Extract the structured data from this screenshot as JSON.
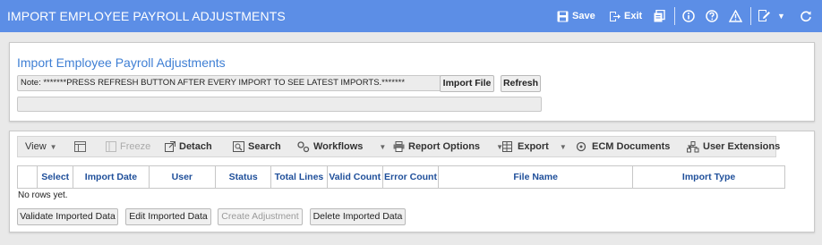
{
  "header": {
    "title": "IMPORT EMPLOYEE PAYROLL ADJUSTMENTS",
    "save_label": "Save",
    "exit_label": "Exit"
  },
  "import_section": {
    "title": "Import Employee Payroll Adjustments",
    "note": "Note: *******PRESS REFRESH BUTTON AFTER EVERY IMPORT TO SEE LATEST IMPORTS.*******",
    "import_file_label": "Import File",
    "refresh_label": "Refresh"
  },
  "toolbar": {
    "view": "View",
    "freeze": "Freeze",
    "detach": "Detach",
    "search": "Search",
    "workflows": "Workflows",
    "report_options": "Report Options",
    "export": "Export",
    "ecm_documents": "ECM Documents",
    "user_extensions": "User Extensions"
  },
  "grid": {
    "columns": [
      "Select",
      "Import Date",
      "User",
      "Status",
      "Total Lines",
      "Valid Count",
      "Error Count",
      "File Name",
      "Import Type"
    ],
    "empty_text": "No rows yet."
  },
  "actions": {
    "validate": "Validate Imported Data",
    "edit": "Edit Imported Data",
    "create": "Create Adjustment",
    "delete": "Delete Imported Data"
  },
  "colors": {
    "header_bg": "#5c8ee6",
    "title_text": "#3f7fd4",
    "column_header_text": "#1f4f9a"
  }
}
